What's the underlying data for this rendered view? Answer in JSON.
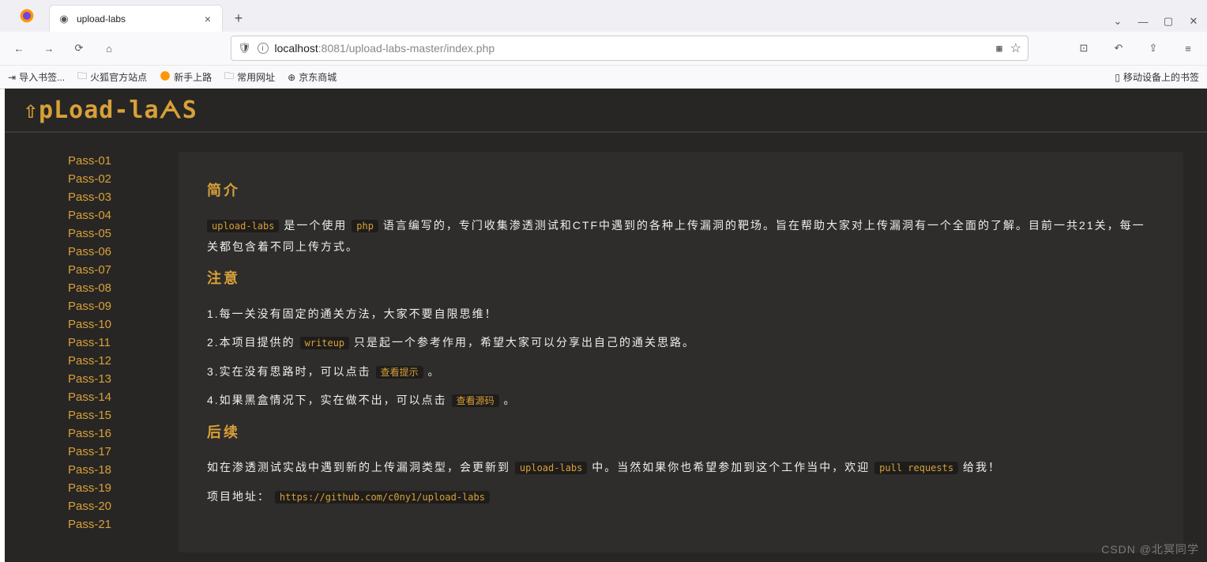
{
  "browser": {
    "tab_title": "upload-labs",
    "url_host": "localhost",
    "url_port_path": ":8081/upload-labs-master/index.php"
  },
  "bookmarks": {
    "import": "导入书签...",
    "firefox_site": "火狐官方站点",
    "new_user": "新手上路",
    "common": "常用网址",
    "jd": "京东商城",
    "mobile": "移动设备上的书签"
  },
  "logo": "⇧pLoad-laᗅS",
  "sidebar": {
    "items": [
      {
        "label": "Pass-01"
      },
      {
        "label": "Pass-02"
      },
      {
        "label": "Pass-03"
      },
      {
        "label": "Pass-04"
      },
      {
        "label": "Pass-05"
      },
      {
        "label": "Pass-06"
      },
      {
        "label": "Pass-07"
      },
      {
        "label": "Pass-08"
      },
      {
        "label": "Pass-09"
      },
      {
        "label": "Pass-10"
      },
      {
        "label": "Pass-11"
      },
      {
        "label": "Pass-12"
      },
      {
        "label": "Pass-13"
      },
      {
        "label": "Pass-14"
      },
      {
        "label": "Pass-15"
      },
      {
        "label": "Pass-16"
      },
      {
        "label": "Pass-17"
      },
      {
        "label": "Pass-18"
      },
      {
        "label": "Pass-19"
      },
      {
        "label": "Pass-20"
      },
      {
        "label": "Pass-21"
      }
    ]
  },
  "content": {
    "h_intro": "简介",
    "intro_p1_a": "是一个使用",
    "intro_p1_b": "语言编写的，专门收集渗透测试和CTF中遇到的各种上传漏洞的靶场。旨在帮助大家对上传漏洞有一个全面的了解。目前一共21关，每一关都包含着不同上传方式。",
    "tag_upload_labs": "upload-labs",
    "tag_php": "php",
    "h_notice": "注意",
    "n1": "1.每一关没有固定的通关方法，大家不要自限思维！",
    "n2_a": "2.本项目提供的",
    "n2_b": "只是起一个参考作用，希望大家可以分享出自己的通关思路。",
    "tag_writeup": "writeup",
    "n3_a": "3.实在没有思路时，可以点击",
    "n3_b": "。",
    "tag_hint": "查看提示",
    "n4_a": "4.如果黑盒情况下，实在做不出，可以点击",
    "n4_b": "。",
    "tag_src": "查看源码",
    "h_follow": "后续",
    "f1_a": "如在渗透测试实战中遇到新的上传漏洞类型，会更新到",
    "f1_b": "中。当然如果你也希望参加到这个工作当中，欢迎",
    "f1_c": "给我！",
    "tag_pr": "pull requests",
    "proj_label": "项目地址：",
    "proj_url": "https://github.com/c0ny1/upload-labs"
  },
  "watermark": "CSDN @北冥同学"
}
